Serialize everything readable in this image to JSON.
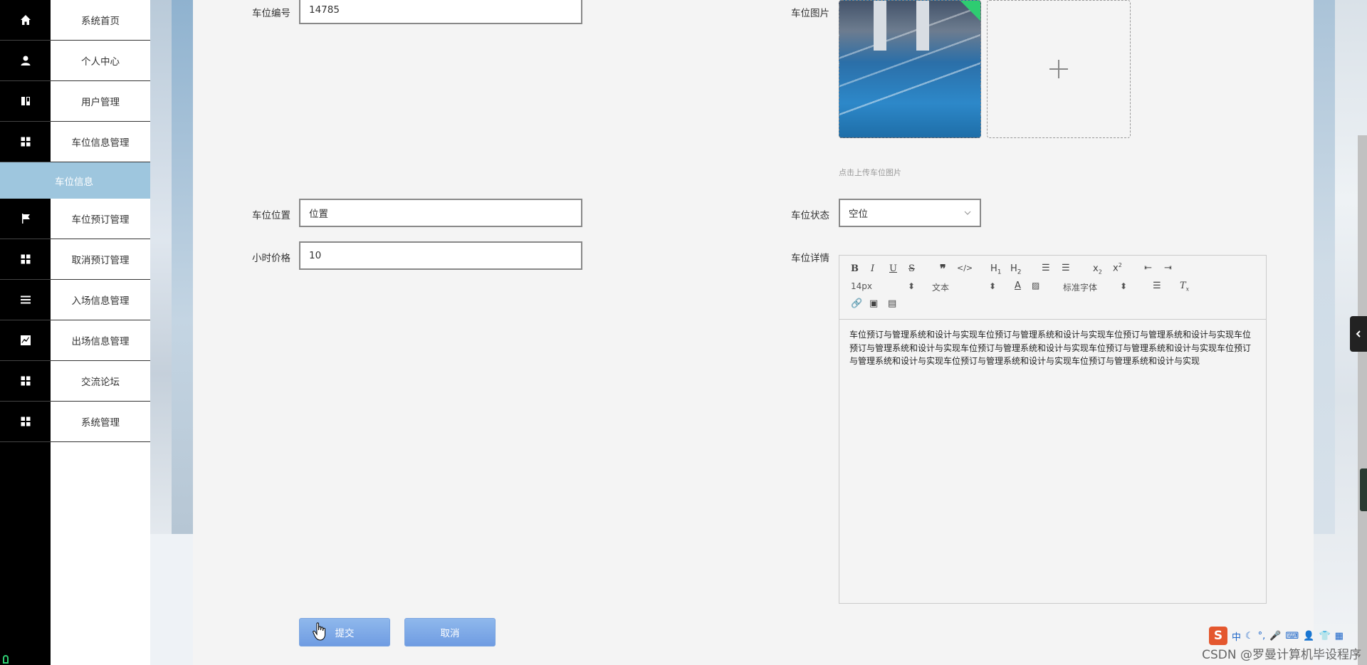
{
  "sidebar": {
    "items": [
      {
        "label": "系统首页",
        "icon": "home-icon"
      },
      {
        "label": "个人中心",
        "icon": "user-icon"
      },
      {
        "label": "用户管理",
        "icon": "book-icon"
      },
      {
        "label": "车位信息管理",
        "icon": "grid-icon"
      },
      {
        "label": "车位预订管理",
        "icon": "flag-icon"
      },
      {
        "label": "取消预订管理",
        "icon": "grid-icon"
      },
      {
        "label": "入场信息管理",
        "icon": "list-icon"
      },
      {
        "label": "出场信息管理",
        "icon": "chart-icon"
      },
      {
        "label": "交流论坛",
        "icon": "grid-icon"
      },
      {
        "label": "系统管理",
        "icon": "grid-icon"
      }
    ],
    "active_sub": "车位信息"
  },
  "form": {
    "parking_no": {
      "label": "车位编号",
      "value": "14785"
    },
    "parking_image": {
      "label": "车位图片",
      "hint": "点击上传车位图片"
    },
    "parking_location": {
      "label": "车位位置",
      "value": "位置"
    },
    "parking_status": {
      "label": "车位状态",
      "value": "空位"
    },
    "hourly_price": {
      "label": "小时价格",
      "value": "10"
    },
    "parking_detail": {
      "label": "车位详情",
      "content": "车位预订与管理系统和设计与实现车位预订与管理系统和设计与实现车位预订与管理系统和设计与实现车位预订与管理系统和设计与实现车位预订与管理系统和设计与实现车位预订与管理系统和设计与实现车位预订与管理系统和设计与实现车位预订与管理系统和设计与实现车位预订与管理系统和设计与实现"
    }
  },
  "editor_toolbar": {
    "font_size": "14px",
    "block_type": "文本",
    "font_family": "标准字体"
  },
  "buttons": {
    "submit": "提交",
    "cancel": "取消"
  },
  "watermark": "CSDN @罗曼计算机毕设程序",
  "ime": {
    "lang": "中"
  }
}
